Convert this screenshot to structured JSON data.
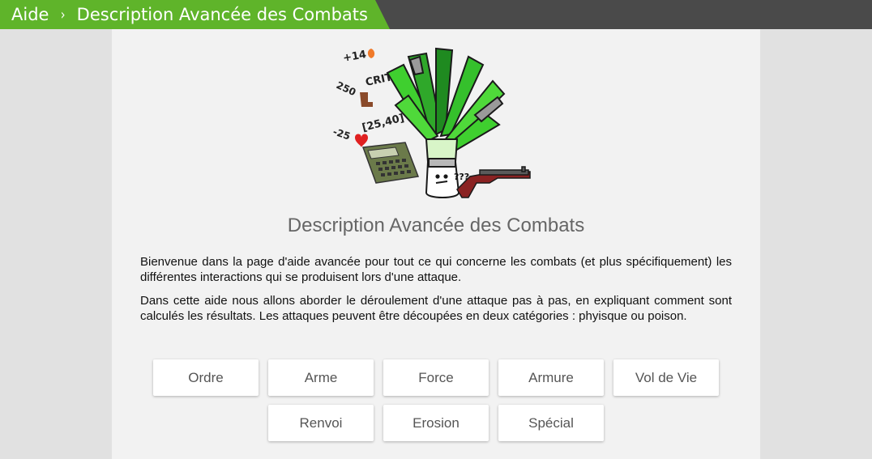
{
  "breadcrumb": {
    "root": "Aide",
    "separator": "›",
    "current": "Description Avancée des Combats"
  },
  "colors": {
    "accent": "#5fb42a",
    "topbar": "#4a4a4a",
    "panel": "#f2f2f2"
  },
  "illustration": {
    "labels": {
      "crit_bonus": "+14",
      "crit": "CRIT",
      "strength": "250",
      "damage_range": "[25,40]",
      "life": "-25",
      "question": "???"
    }
  },
  "page": {
    "title": "Description Avancée des Combats",
    "paragraphs": [
      "Bienvenue dans la page d'aide avancée pour tout ce qui concerne les combats (et plus spécifiquement) les différentes interactions qui se produisent lors d'une attaque.",
      "Dans cette aide nous allons aborder le déroulement d'une attaque pas à pas, en expliquant comment sont calculés les résultats. Les attaques peuvent être découpées en deux catégories : phyisque ou poison."
    ]
  },
  "buttons": {
    "row1": [
      "Ordre",
      "Arme",
      "Force",
      "Armure",
      "Vol de Vie"
    ],
    "row2": [
      "Renvoi",
      "Erosion",
      "Spécial"
    ]
  }
}
